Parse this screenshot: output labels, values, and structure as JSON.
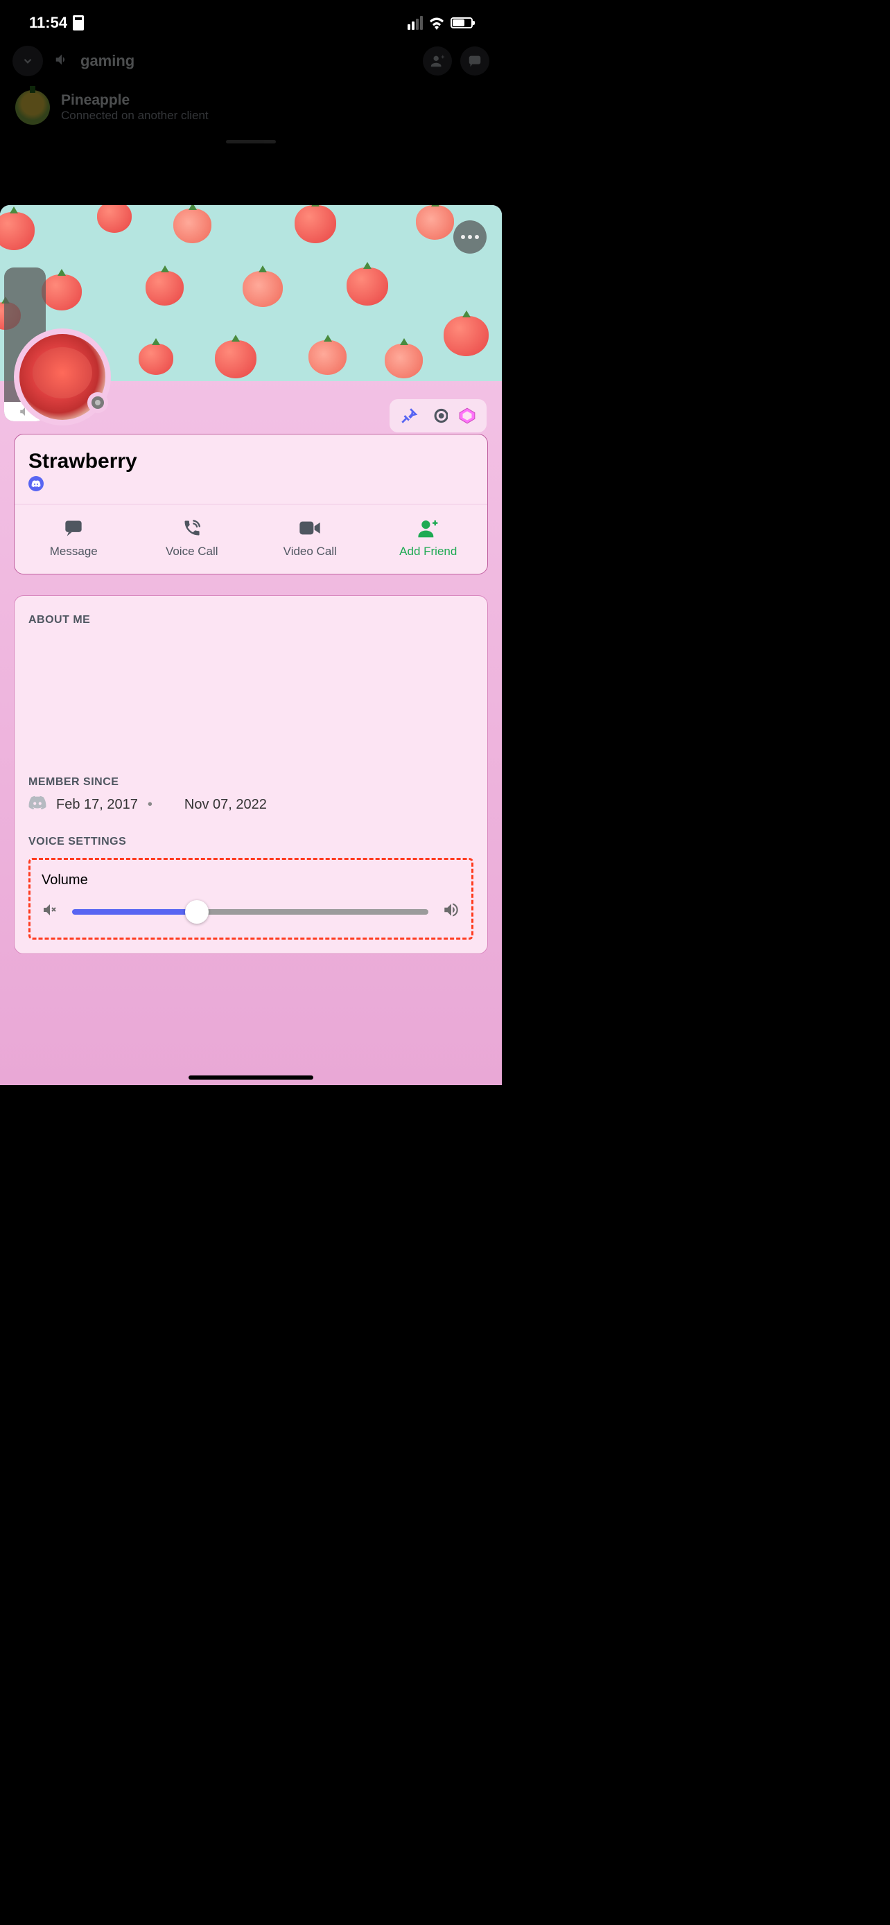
{
  "status": {
    "time": "11:54",
    "signal_bars": 2,
    "wifi": true,
    "battery_pct": 60
  },
  "background": {
    "channel_name": "gaming",
    "user": {
      "name": "Pineapple",
      "status": "Connected on another client"
    }
  },
  "profile": {
    "display_name": "Strawberry",
    "status_presence": "offline",
    "badges": [
      "hypesquad-tools",
      "nitro",
      "boost"
    ]
  },
  "actions": {
    "message": "Message",
    "voice_call": "Voice Call",
    "video_call": "Video Call",
    "add_friend": "Add Friend"
  },
  "sections": {
    "about_title": "ABOUT ME",
    "member_title": "MEMBER SINCE",
    "member_discord_date": "Feb 17, 2017",
    "member_server_date": "Nov 07, 2022",
    "voice_title": "VOICE SETTINGS",
    "volume_label": "Volume",
    "volume_value_pct": 35
  },
  "colors": {
    "accent_green": "#1faa53",
    "slider_active": "#5865f2",
    "highlight_dash": "#ff3b1f",
    "sheet_bg_top": "#f5c7e8",
    "banner_bg": "#b5e5e0"
  }
}
